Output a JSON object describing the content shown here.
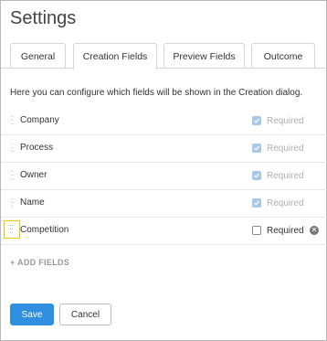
{
  "title": "Settings",
  "tabs": [
    {
      "label": "General"
    },
    {
      "label": "Creation Fields"
    },
    {
      "label": "Preview Fields"
    },
    {
      "label": "Outcome"
    }
  ],
  "active_tab": "Creation Fields",
  "description": "Here you can configure which fields will be shown in the Creation dialog.",
  "fields": [
    {
      "name": "Company",
      "required_label": "Required",
      "required_checked": true,
      "locked": true
    },
    {
      "name": "Process",
      "required_label": "Required",
      "required_checked": true,
      "locked": true
    },
    {
      "name": "Owner",
      "required_label": "Required",
      "required_checked": true,
      "locked": true
    },
    {
      "name": "Name",
      "required_label": "Required",
      "required_checked": true,
      "locked": true
    },
    {
      "name": "Competition",
      "required_label": "Required",
      "required_checked": false,
      "locked": false
    }
  ],
  "add_fields_label": "+ ADD FIELDS",
  "save_label": "Save",
  "cancel_label": "Cancel",
  "colors": {
    "primary": "#2f8fe0",
    "highlight": "#f1c400",
    "checked": "#a9c8e6"
  },
  "icons": {
    "drag": "drag-handle-icon",
    "remove": "remove-circle-icon",
    "check": "checkmark-icon"
  }
}
